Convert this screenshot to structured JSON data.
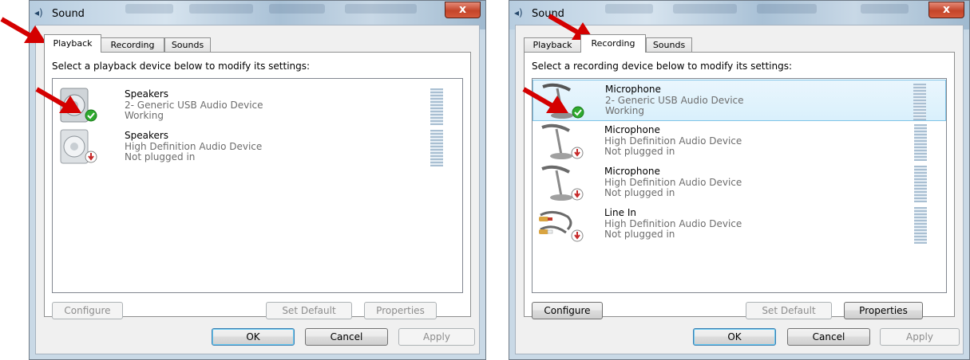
{
  "colors": {
    "accent": "#d40000",
    "selection": "#d9f0fc",
    "ok_check": "#2eaa2e",
    "unplugged": "#c62828"
  },
  "windows": [
    {
      "title": "Sound",
      "close_label": "x",
      "tabs": [
        {
          "label": "Playback"
        },
        {
          "label": "Recording"
        },
        {
          "label": "Sounds"
        }
      ],
      "active_tab": 0,
      "instruction": "Select a playback device below to modify its settings:",
      "devices": [
        {
          "name": "Speakers",
          "desc": "2- Generic USB Audio Device",
          "status": "Working",
          "icon": "speaker-icon",
          "badge": "check-badge-icon"
        },
        {
          "name": "Speakers",
          "desc": "High Definition Audio Device",
          "status": "Not plugged in",
          "icon": "speaker-icon",
          "badge": "unplugged-badge-icon"
        }
      ],
      "buttons": {
        "configure": "Configure",
        "set_default": "Set Default",
        "properties": "Properties",
        "ok": "OK",
        "cancel": "Cancel",
        "apply": "Apply"
      }
    },
    {
      "title": "Sound",
      "close_label": "x",
      "tabs": [
        {
          "label": "Playback"
        },
        {
          "label": "Recording"
        },
        {
          "label": "Sounds"
        }
      ],
      "active_tab": 1,
      "instruction": "Select a recording device below to modify its settings:",
      "devices": [
        {
          "name": "Microphone",
          "desc": "2- Generic USB Audio Device",
          "status": "Working",
          "icon": "microphone-icon",
          "badge": "check-badge-icon"
        },
        {
          "name": "Microphone",
          "desc": "High Definition Audio Device",
          "status": "Not plugged in",
          "icon": "microphone-icon",
          "badge": "unplugged-badge-icon"
        },
        {
          "name": "Microphone",
          "desc": "High Definition Audio Device",
          "status": "Not plugged in",
          "icon": "microphone-icon",
          "badge": "unplugged-badge-icon"
        },
        {
          "name": "Line In",
          "desc": "High Definition Audio Device",
          "status": "Not plugged in",
          "icon": "line-in-cable-icon",
          "badge": "unplugged-badge-icon"
        }
      ],
      "buttons": {
        "configure": "Configure",
        "set_default": "Set Default",
        "properties": "Properties",
        "ok": "OK",
        "cancel": "Cancel",
        "apply": "Apply"
      }
    }
  ]
}
